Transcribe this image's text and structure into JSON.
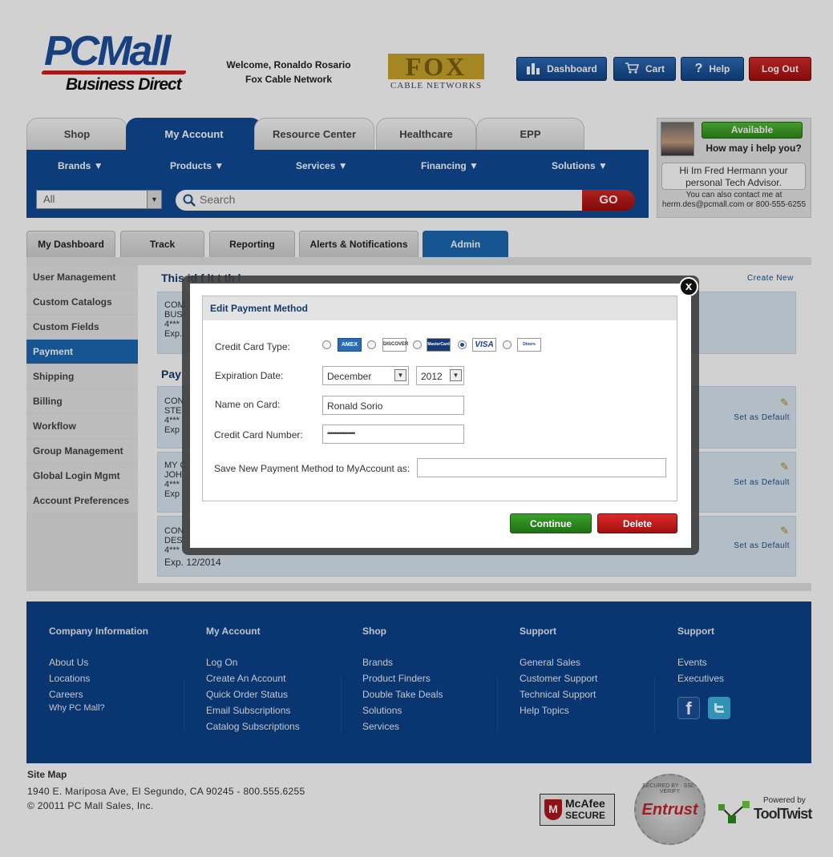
{
  "header": {
    "logo_top": "PCMall",
    "logo_bottom": "Business Direct",
    "welcome_line1": "Welcome, Ronaldo Rosario",
    "welcome_line2": "Fox Cable Network",
    "partner_logo_big": "FOX",
    "partner_logo_small": "CABLE NETWORKS",
    "buttons": {
      "dashboard": "Dashboard",
      "cart": "Cart",
      "help": "Help",
      "logout": "Log Out"
    }
  },
  "main_tabs": [
    "Shop",
    "My Account",
    "Resource Center",
    "Healthcare",
    "EPP"
  ],
  "nav_items": [
    "Brands",
    "Products",
    "Services",
    "Financing",
    "Solutions"
  ],
  "search": {
    "category": "All",
    "placeholder": "Search",
    "go": "GO"
  },
  "chat": {
    "status": "Available",
    "prompt": "How may i help you?",
    "advisor": "Hi Im Fred Hermann your personal Tech Advisor.",
    "contact1": "You can also contact me at",
    "contact2": "herm.des@pcmall.com or 800-555-6255"
  },
  "account_tabs": [
    "My Dashboard",
    "Track",
    "Reporting",
    "Alerts & Notifications",
    "Admin"
  ],
  "sidebar": [
    "User Management",
    "Custom Catalogs",
    "Custom Fields",
    "Payment",
    "Shipping",
    "Billing",
    "Workflow",
    "Group Management",
    "Global Login Mgmt",
    "Account Preferences"
  ],
  "content": {
    "heading_partial": "This i",
    "heading_partial2": "d f    lt      t    th  l",
    "create_new": "Create New",
    "payment_heading_partial": "Pay",
    "default_block": [
      "COM",
      "BUS",
      "4***",
      "Exp."
    ],
    "rows": [
      {
        "lines": [
          "CON",
          "STE",
          "4***",
          "Exp"
        ],
        "action": "Set as Default"
      },
      {
        "lines": [
          "MY C",
          "JOH",
          "4***",
          "Exp"
        ],
        "action": "Set as Default"
      },
      {
        "lines": [
          "CON",
          "DES",
          "4***",
          "Exp. 12/2014"
        ],
        "action": "Set as Default"
      }
    ]
  },
  "modal": {
    "title": "Edit Payment Method",
    "card_type_label": "Credit Card Type:",
    "cards": [
      "AMEX",
      "DISCOVER",
      "MasterCard",
      "VISA",
      "Diners"
    ],
    "selected_card": "MasterCard",
    "expiration_label": "Expiration Date:",
    "exp_month": "December",
    "exp_year": "2012",
    "name_label": "Name on Card:",
    "name_value": "Ronald Sorio",
    "number_label": "Credit Card Number:",
    "number_value": "••••••••••••••••",
    "save_label": "Save New Payment Method to MyAccount as:",
    "save_value": "",
    "continue": "Continue",
    "delete": "Delete",
    "close": "x"
  },
  "footer": {
    "columns": [
      {
        "title": "Company Information",
        "links": [
          "About Us",
          "Locations",
          "Careers"
        ],
        "small_link": "Why PC Mall?"
      },
      {
        "title": "My Account",
        "links": [
          "Log On",
          "Create An Account",
          "Quick Order Status",
          "Email Subscriptions",
          "Catalog Subscriptions"
        ]
      },
      {
        "title": "Shop",
        "links": [
          "Brands",
          "Product Finders",
          "Double Take Deals",
          "Solutions",
          "Services"
        ]
      },
      {
        "title": "Support",
        "links": [
          "General Sales",
          "Customer Support",
          "Technical Support",
          "Help Topics"
        ]
      },
      {
        "title": "Support",
        "links": [
          "Events",
          "Executives"
        ]
      }
    ]
  },
  "bottom": {
    "sitemap": "Site Map",
    "address": "1940 E. Mariposa Ave, El Segundo, CA 90245 - 800.555.6255",
    "copyright": "© 20011 PC Mall Sales, Inc.",
    "mcafee_top": "McAfee",
    "mcafee_bottom": "SECURE",
    "entrust": "Entrust",
    "entrust_ring": "SECURED BY · SSL · VERIFY",
    "powered_by": "Powered by",
    "tooltwist": "ToolTwist"
  },
  "colors": {
    "brand_blue": "#0f4a94",
    "accent_red": "#c8201f",
    "continue_green": "#2a8a1e",
    "delete_red": "#c51a1a",
    "available_green": "#3ea424"
  }
}
